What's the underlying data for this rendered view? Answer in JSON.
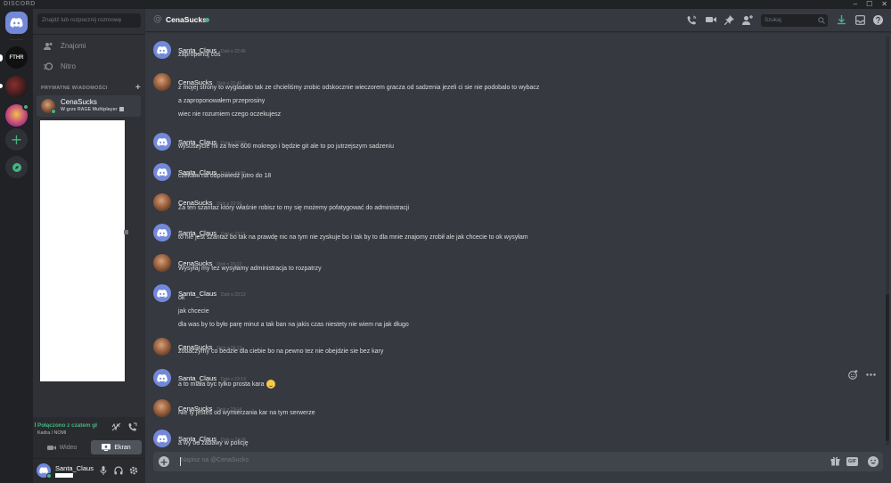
{
  "titlebar": {
    "brand": "DISCORD"
  },
  "servers": [
    {
      "label": "FTHR"
    }
  ],
  "sidebar": {
    "search_placeholder": "Znajdź lub rozpocznij rozmowę",
    "nav": [
      {
        "label": "Znajomi",
        "icon": "friends-icon"
      },
      {
        "label": "Nitro",
        "icon": "nitro-icon"
      }
    ],
    "dm_header": "PRYWATNE WIADOMOŚCI",
    "dm": {
      "name": "CenaSucks",
      "activity": "W grze RAGE Multiplayer"
    }
  },
  "voice": {
    "status": "Połączono z czatem gł",
    "channel": "Kadra / NOMI",
    "video_label": "Wideo",
    "screen_label": "Ekran"
  },
  "user": {
    "name": "Santa_Claus"
  },
  "header": {
    "channel": "CenaSucks",
    "search_placeholder": "Szukaj"
  },
  "messages": [
    {
      "author": "Santa_Claus",
      "avatar": "santa",
      "time": "Dziś o 22:46",
      "lines": [
        "zaproponuj coś"
      ]
    },
    {
      "author": "CenaSucks",
      "avatar": "cena",
      "time": "Dziś o 22:48",
      "lines": [
        "z mojej strony to wygladało tak ze chcieliśmy zrobic odskocznie wieczorem gracza od sadzenia jezeli ci sie nie podobalo to wybacz",
        "a zaproponowałem przeprosiny",
        "wiec nie rozumiem czego oczekujesz"
      ]
    },
    {
      "author": "Santa_Claus",
      "avatar": "santa",
      "time": "Dziś o 22:53",
      "lines": [
        "wysuszycie mi za free 600 mokrego i będzie git ale to po jutrzejszym sadzeniu"
      ]
    },
    {
      "author": "Santa_Claus",
      "avatar": "santa",
      "time": "Dziś o 23:05",
      "lines": [
        "czekam na odpowiedź jutro do 18"
      ]
    },
    {
      "author": "CenaSucks",
      "avatar": "cena",
      "time": "Dziś o 23:06",
      "lines": [
        "Za ten szantaz który właśnie robisz to my się możemy pofatygować do administracji"
      ]
    },
    {
      "author": "Santa_Claus",
      "avatar": "santa",
      "time": "Dziś o 23:11",
      "lines": [
        "to nie jest szantaż bo tak na prawdę nic na tym nie zyskuje bo i tak by to dla mnie znajomy zrobił ale jak chcecie to ok wysyłam"
      ]
    },
    {
      "author": "CenaSucks",
      "avatar": "cena",
      "time": "Dziś o 23:12",
      "lines": [
        "Wysyłaj my tez wysyłamy administracja to rozpatrzy"
      ]
    },
    {
      "author": "Santa_Claus",
      "avatar": "santa",
      "time": "Dziś o 23:12",
      "lines": [
        "ok",
        "jak chcecie",
        "dla was by to było parę minut a tak ban na jakis czas niestety nie wiem na jak długo"
      ]
    },
    {
      "author": "CenaSucks",
      "avatar": "cena",
      "time": "Dziś o 23:13",
      "lines": [
        "zobaczymy co bedzie dla ciebie bo na pewno tez nie obejdzie sie bez kary"
      ]
    },
    {
      "author": "Santa_Claus",
      "avatar": "santa",
      "time": "Dziś o 23:13",
      "lines": [
        "a to miała byc tylko prosta kara"
      ]
    },
    {
      "author": "CenaSucks",
      "avatar": "cena",
      "time": "Dziś o 23:14",
      "lines": [
        "Nie ty jesteś od wymierzania kar na tym serwerze"
      ]
    },
    {
      "author": "Santa_Claus",
      "avatar": "santa",
      "time": "Dziś o 23:15",
      "lines": [
        "a wy od zabawy w policję"
      ]
    }
  ],
  "composer": {
    "placeholder": "Napisz na @CenaSucks",
    "gif_label": "GIF"
  },
  "colors": {
    "accent": "#7289da",
    "online": "#43b581",
    "background": "#36393f",
    "sidebar": "#2f3136",
    "rail": "#202225"
  }
}
